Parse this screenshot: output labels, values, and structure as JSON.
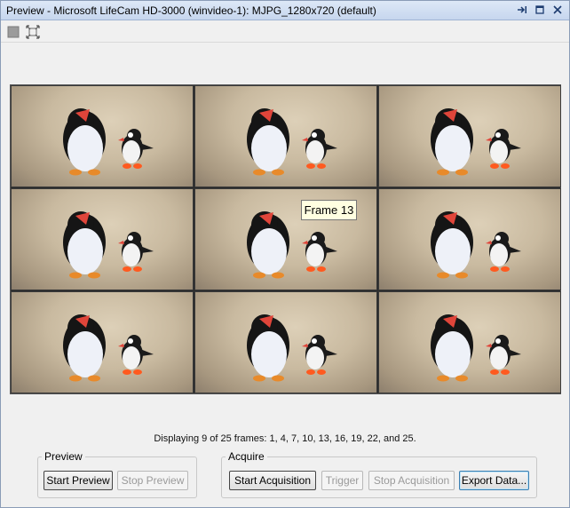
{
  "window": {
    "title": "Preview - Microsoft LifeCam HD-3000 (winvideo-1): MJPG_1280x720 (default)",
    "title_buttons": [
      "undock-icon",
      "maximize-icon",
      "close-icon"
    ]
  },
  "toolbar": {
    "tools": [
      "stop-preview-icon",
      "fit-to-window-icon"
    ]
  },
  "preview": {
    "tile_count": 9,
    "tooltip": "Frame 13"
  },
  "status": {
    "text": "Displaying 9 of 25 frames: 1, 4, 7, 10, 13, 16, 19, 22, and 25."
  },
  "preview_group": {
    "legend": "Preview",
    "start_label": "Start Preview",
    "stop_label": "Stop Preview"
  },
  "acquire_group": {
    "legend": "Acquire",
    "start_label": "Start Acquisition",
    "trigger_label": "Trigger",
    "stop_label": "Stop Acquisition",
    "export_label": "Export Data..."
  },
  "colors": {
    "titlebar": "#c6d6ee",
    "tooltip_bg": "#ffffe1",
    "focus_border": "#3c7fb1"
  }
}
